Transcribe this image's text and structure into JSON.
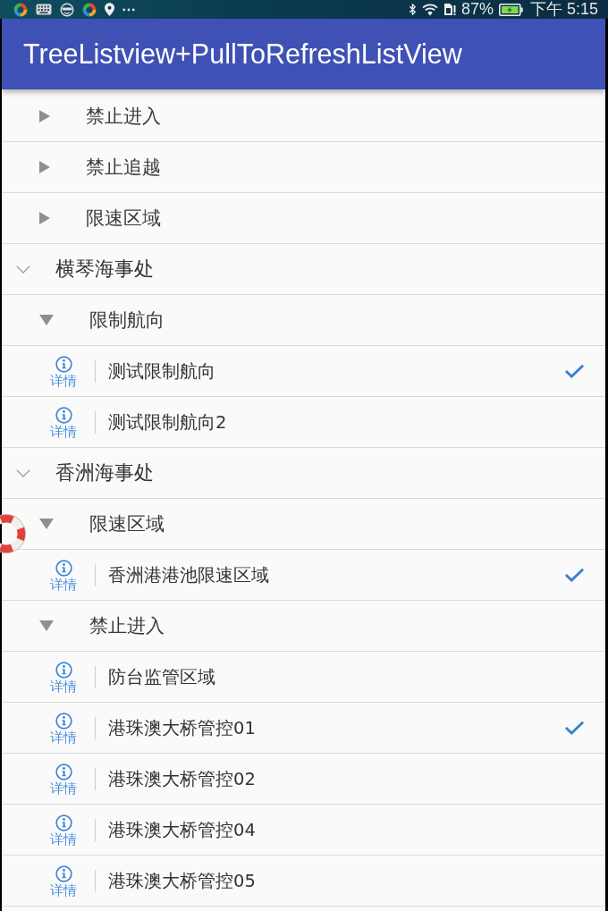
{
  "status_bar": {
    "battery": "87%",
    "time": "下午 5:15"
  },
  "app_bar": {
    "title": "TreeListview+PullToRefreshListView"
  },
  "tree": [
    {
      "children": [
        {
          "kind": "category",
          "label": "禁止进入",
          "expanded": false
        },
        {
          "kind": "category",
          "label": "禁止追越",
          "expanded": false
        },
        {
          "kind": "category",
          "label": "限速区域",
          "expanded": false
        }
      ]
    },
    {
      "kind": "office",
      "label": "横琴海事处",
      "expanded": true,
      "children": [
        {
          "kind": "category",
          "label": "限制航向",
          "expanded": true,
          "children": [
            {
              "kind": "item",
              "details": "详情",
              "label": "测试限制航向",
              "checked": true
            },
            {
              "kind": "item",
              "details": "详情",
              "label": "测试限制航向2",
              "checked": false
            }
          ]
        }
      ]
    },
    {
      "kind": "office",
      "label": "香洲海事处",
      "expanded": true,
      "children": [
        {
          "kind": "category",
          "label": "限速区域",
          "expanded": true,
          "children": [
            {
              "kind": "item",
              "details": "详情",
              "label": "香洲港港池限速区域",
              "checked": true
            }
          ]
        },
        {
          "kind": "category",
          "label": "禁止进入",
          "expanded": true,
          "children": [
            {
              "kind": "item",
              "details": "详情",
              "label": "防台监管区域",
              "checked": false
            },
            {
              "kind": "item",
              "details": "详情",
              "label": "港珠澳大桥管控01",
              "checked": true
            },
            {
              "kind": "item",
              "details": "详情",
              "label": "港珠澳大桥管控02",
              "checked": false
            },
            {
              "kind": "item",
              "details": "详情",
              "label": "港珠澳大桥管控04",
              "checked": false
            },
            {
              "kind": "item",
              "details": "详情",
              "label": "港珠澳大桥管控05",
              "checked": false
            }
          ]
        }
      ]
    }
  ]
}
